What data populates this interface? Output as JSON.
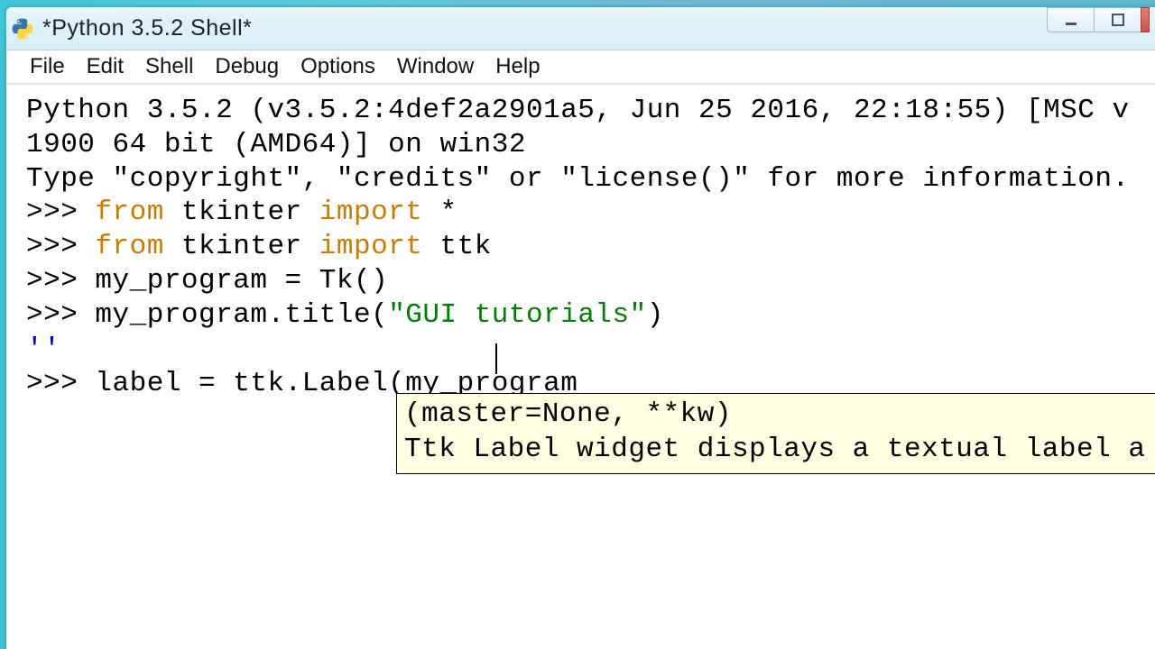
{
  "window": {
    "title": "*Python 3.5.2 Shell*"
  },
  "menu": {
    "file": "File",
    "edit": "Edit",
    "shell": "Shell",
    "debug": "Debug",
    "options": "Options",
    "window": "Window",
    "help": "Help"
  },
  "shell": {
    "banner_l1": "Python 3.5.2 (v3.5.2:4def2a2901a5, Jun 25 2016, 22:18:55) [MSC v",
    "banner_l2": "1900 64 bit (AMD64)] on win32",
    "banner_l3": "Type \"copyright\", \"credits\" or \"license()\" for more information.",
    "prompt": ">>> ",
    "line1_pre": "from",
    "line1_mid": " tkinter ",
    "line1_imp": "import",
    "line1_post": " *",
    "line2_pre": "from",
    "line2_mid": " tkinter ",
    "line2_imp": "import",
    "line2_post": " ttk",
    "line3": "my_program = Tk()",
    "line4_pre": "my_program.title(",
    "line4_str": "\"GUI tutorials\"",
    "line4_post": ")",
    "out1": "''",
    "line5": "label = ttk.Label(my_program"
  },
  "tooltip": {
    "sig": "(master=None, **kw)",
    "desc": "Ttk Label widget displays a textual label a"
  }
}
